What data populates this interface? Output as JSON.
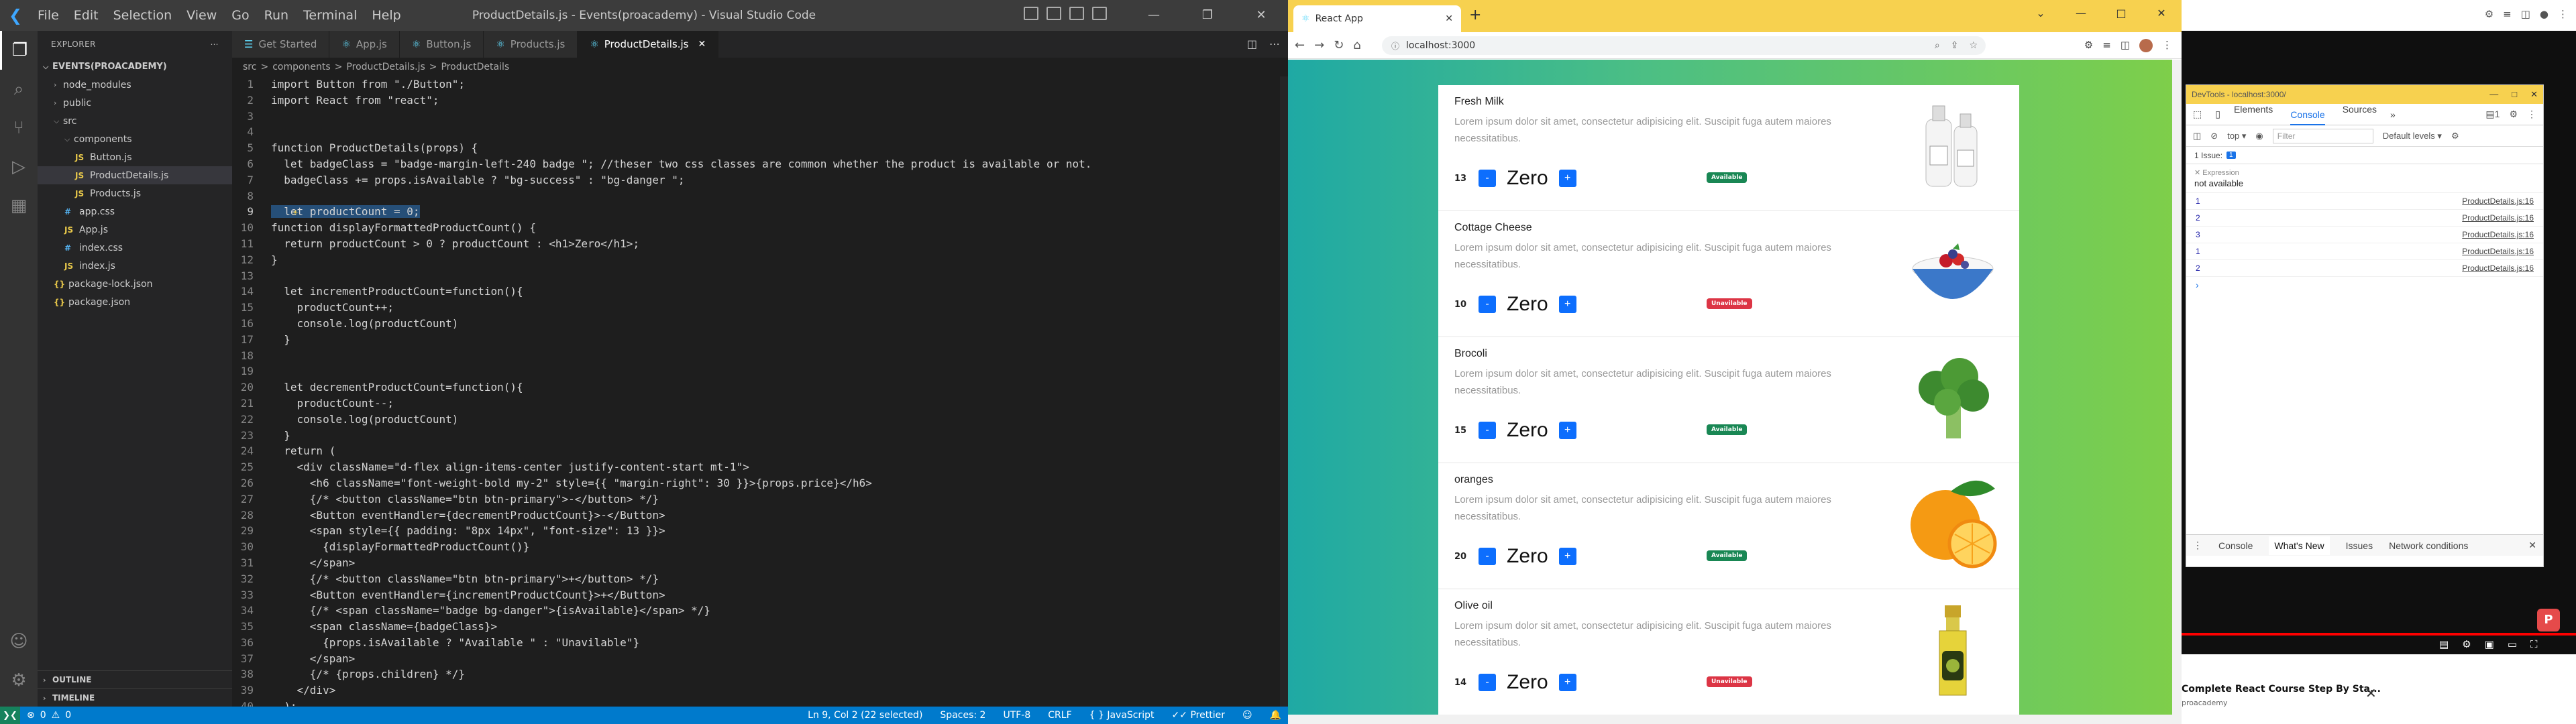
{
  "vscode": {
    "window_title": "ProductDetails.js - Events(proacademy) - Visual Studio Code",
    "menu": [
      "File",
      "Edit",
      "Selection",
      "View",
      "Go",
      "Run",
      "Terminal",
      "Help"
    ],
    "explorer_label": "EXPLORER",
    "project_name": "EVENTS(PROACADEMY)",
    "tree": [
      {
        "label": "node_modules",
        "type": "folder-closed",
        "indent": 1
      },
      {
        "label": "public",
        "type": "folder-closed",
        "indent": 1
      },
      {
        "label": "src",
        "type": "folder-open",
        "indent": 1
      },
      {
        "label": "components",
        "type": "folder-open",
        "indent": 2
      },
      {
        "label": "Button.js",
        "type": "js",
        "indent": 3
      },
      {
        "label": "ProductDetails.js",
        "type": "js",
        "indent": 3,
        "selected": true
      },
      {
        "label": "Products.js",
        "type": "js",
        "indent": 3
      },
      {
        "label": "app.css",
        "type": "css",
        "indent": 2
      },
      {
        "label": "App.js",
        "type": "js",
        "indent": 2
      },
      {
        "label": "index.css",
        "type": "css",
        "indent": 2
      },
      {
        "label": "index.js",
        "type": "js",
        "indent": 2
      },
      {
        "label": "package-lock.json",
        "type": "json",
        "indent": 1
      },
      {
        "label": "package.json",
        "type": "json",
        "indent": 1
      }
    ],
    "outline_label": "OUTLINE",
    "timeline_label": "TIMELINE",
    "tabs": [
      {
        "label": "Get Started",
        "active": false
      },
      {
        "label": "App.js",
        "active": false
      },
      {
        "label": "Button.js",
        "active": false
      },
      {
        "label": "Products.js",
        "active": false
      },
      {
        "label": "ProductDetails.js",
        "active": true
      }
    ],
    "breadcrumb": [
      "src",
      ">",
      "components",
      ">",
      "ProductDetails.js",
      ">",
      "ProductDetails"
    ],
    "code_lines": [
      {
        "n": "1",
        "text": "import Button from \"./Button\";"
      },
      {
        "n": "2",
        "text": "import React from \"react\";"
      },
      {
        "n": "3",
        "text": ""
      },
      {
        "n": "4",
        "text": ""
      },
      {
        "n": "5",
        "text": "function ProductDetails(props) {"
      },
      {
        "n": "6",
        "text": "  let badgeClass = \"badge-margin-left-240 badge \"; //theser two css classes are common whether the product is available or not."
      },
      {
        "n": "7",
        "text": "  badgeClass += props.isAvailable ? \"bg-success\" : \"bg-danger \";"
      },
      {
        "n": "8",
        "text": ""
      },
      {
        "n": "9",
        "text": "  let productCount = 0;",
        "current": true
      },
      {
        "n": "10",
        "text": "function displayFormattedProductCount() {"
      },
      {
        "n": "11",
        "text": "  return productCount > 0 ? productCount : <h1>Zero</h1>;"
      },
      {
        "n": "12",
        "text": "}"
      },
      {
        "n": "13",
        "text": ""
      },
      {
        "n": "14",
        "text": "  let incrementProductCount=function(){"
      },
      {
        "n": "15",
        "text": "    productCount++;"
      },
      {
        "n": "16",
        "text": "    console.log(productCount)"
      },
      {
        "n": "17",
        "text": "  }"
      },
      {
        "n": "18",
        "text": ""
      },
      {
        "n": "19",
        "text": ""
      },
      {
        "n": "20",
        "text": "  let decrementProductCount=function(){"
      },
      {
        "n": "21",
        "text": "    productCount--;"
      },
      {
        "n": "22",
        "text": "    console.log(productCount)"
      },
      {
        "n": "23",
        "text": "  }"
      },
      {
        "n": "24",
        "text": "  return ("
      },
      {
        "n": "25",
        "text": "    <div className=\"d-flex align-items-center justify-content-start mt-1\">"
      },
      {
        "n": "26",
        "text": "      <h6 className=\"font-weight-bold my-2\" style={{ \"margin-right\": 30 }}>{props.price}</h6>"
      },
      {
        "n": "27",
        "text": "      {/* <button className=\"btn btn-primary\">-</button> */}"
      },
      {
        "n": "28",
        "text": "      <Button eventHandler={decrementProductCount}>-</Button>"
      },
      {
        "n": "29",
        "text": "      <span style={{ padding: \"8px 14px\", \"font-size\": 13 }}>"
      },
      {
        "n": "30",
        "text": "        {displayFormattedProductCount()}"
      },
      {
        "n": "31",
        "text": "      </span>"
      },
      {
        "n": "32",
        "text": "      {/* <button className=\"btn btn-primary\">+</button> */}"
      },
      {
        "n": "33",
        "text": "      <Button eventHandler={incrementProductCount}>+</Button>"
      },
      {
        "n": "34",
        "text": "      {/* <span className=\"badge bg-danger\">{isAvailable}</span> */}"
      },
      {
        "n": "35",
        "text": "      <span className={badgeClass}>"
      },
      {
        "n": "36",
        "text": "        {props.isAvailable ? \"Available \" : \"Unavilable\"}"
      },
      {
        "n": "37",
        "text": "      </span>"
      },
      {
        "n": "38",
        "text": "      {/* {props.children} */}"
      },
      {
        "n": "39",
        "text": "    </div>"
      },
      {
        "n": "40",
        "text": "  );"
      }
    ],
    "status": {
      "errors": "0",
      "warnings": "0",
      "position": "Ln 9, Col 2 (22 selected)",
      "spaces": "Spaces: 2",
      "encoding": "UTF-8",
      "eol": "CRLF",
      "language": "JavaScript",
      "prettier": "Prettier"
    }
  },
  "chrome": {
    "tab_title": "React App",
    "url": "localhost:3000",
    "products": [
      {
        "name": "Fresh Milk",
        "desc": "Lorem ipsum dolor sit amet, consectetur adipisicing elit. Suscipit fuga autem maiores necessitatibus.",
        "price": "13",
        "count": "Zero",
        "badge": "Available",
        "available": true,
        "image": "milk"
      },
      {
        "name": "Cottage Cheese",
        "desc": "Lorem ipsum dolor sit amet, consectetur adipisicing elit. Suscipit fuga autem maiores necessitatibus.",
        "price": "10",
        "count": "Zero",
        "badge": "Unavilable",
        "available": false,
        "image": "cheese"
      },
      {
        "name": "Brocoli",
        "desc": "Lorem ipsum dolor sit amet, consectetur adipisicing elit. Suscipit fuga autem maiores necessitatibus.",
        "price": "15",
        "count": "Zero",
        "badge": "Available",
        "available": true,
        "image": "broccoli"
      },
      {
        "name": "oranges",
        "desc": "Lorem ipsum dolor sit amet, consectetur adipisicing elit. Suscipit fuga autem maiores necessitatibus.",
        "price": "20",
        "count": "Zero",
        "badge": "Available",
        "available": true,
        "image": "orange"
      },
      {
        "name": "Olive oil",
        "desc": "Lorem ipsum dolor sit amet, consectetur adipisicing elit. Suscipit fuga autem maiores necessitatibus.",
        "price": "14",
        "count": "Zero",
        "badge": "Unavilable",
        "available": false,
        "image": "oil"
      }
    ],
    "decrement_label": "-",
    "increment_label": "+"
  },
  "devtools": {
    "title": "DevTools - localhost:3000/",
    "tabs": [
      "Elements",
      "Console",
      "Sources"
    ],
    "active_tab": "Console",
    "context": "top",
    "filter_placeholder": "Filter",
    "levels": "Default levels",
    "issues": "1 Issue:",
    "issue_count": "1",
    "expression_label": "Expression",
    "expression_value": "not available",
    "logs": [
      {
        "value": "1",
        "source": "ProductDetails.js:16"
      },
      {
        "value": "2",
        "source": "ProductDetails.js:16"
      },
      {
        "value": "3",
        "source": "ProductDetails.js:16"
      },
      {
        "value": "1",
        "source": "ProductDetails.js:16"
      },
      {
        "value": "2",
        "source": "ProductDetails.js:16"
      }
    ],
    "drawer_tabs": [
      "Console",
      "What's New",
      "Issues",
      "Network conditions"
    ],
    "drawer_active": "What's New"
  },
  "video": {
    "title": "Complete React Course Step By Sta...",
    "channel": "proacademy"
  },
  "colors": {
    "vscode_status": "#007acc",
    "chrome_tabbar": "#f7d14f",
    "bootstrap_primary": "#0d6efd",
    "badge_success": "#198754",
    "badge_danger": "#dc3545"
  }
}
